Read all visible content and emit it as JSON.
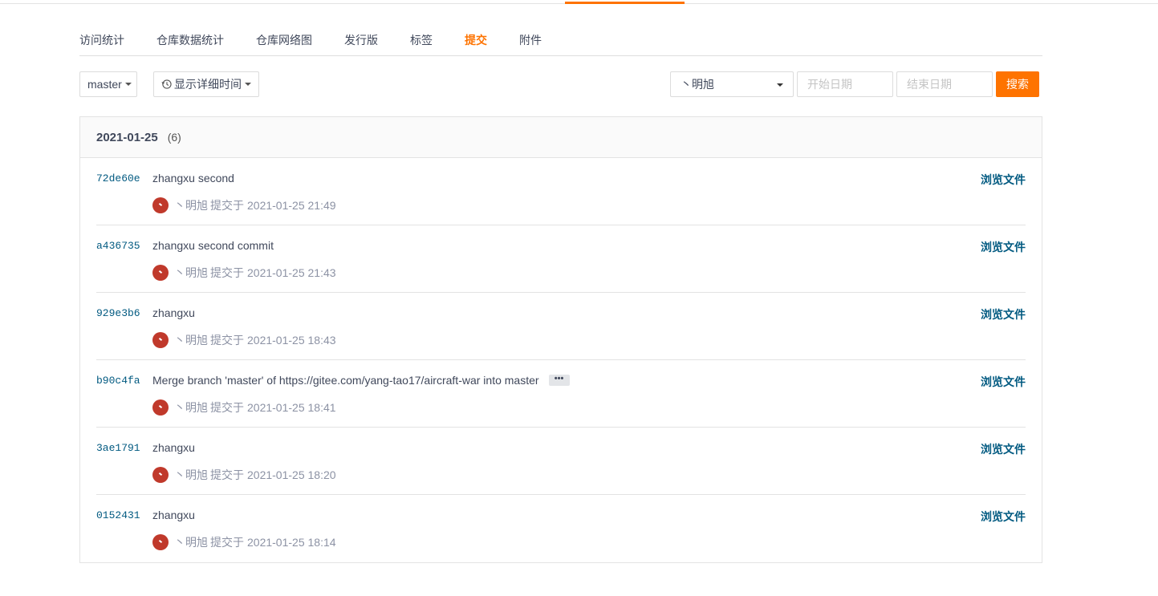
{
  "colors": {
    "accent": "#fe7300",
    "link": "#005980",
    "text": "#40485b",
    "muted": "#8c92a4",
    "avatar_bg": "#c0392b"
  },
  "subnav": {
    "items": [
      {
        "label": "访问统计"
      },
      {
        "label": "仓库数据统计"
      },
      {
        "label": "仓库网络图"
      },
      {
        "label": "发行版"
      },
      {
        "label": "标签"
      },
      {
        "label": "提交",
        "active": true
      },
      {
        "label": "附件"
      }
    ]
  },
  "toolbar": {
    "branch_label": "master",
    "time_toggle_label": "显示详细时间",
    "author_value": "丶明旭",
    "start_date_placeholder": "开始日期",
    "end_date_placeholder": "结束日期",
    "search_label": "搜索"
  },
  "group": {
    "date": "2021-01-25",
    "count": "(6)"
  },
  "commits": [
    {
      "sha": "72de60e",
      "message": "zhangxu second",
      "author": "丶明旭",
      "action": "提交于",
      "time": "2021-01-25 21:49",
      "browse": "浏览文件"
    },
    {
      "sha": "a436735",
      "message": "zhangxu second commit",
      "author": "丶明旭",
      "action": "提交于",
      "time": "2021-01-25 21:43",
      "browse": "浏览文件"
    },
    {
      "sha": "929e3b6",
      "message": "zhangxu",
      "author": "丶明旭",
      "action": "提交于",
      "time": "2021-01-25 18:43",
      "browse": "浏览文件"
    },
    {
      "sha": "b90c4fa",
      "message": "Merge branch 'master' of https://gitee.com/yang-tao17/aircraft-war into master",
      "ellipsis": "•••",
      "author": "丶明旭",
      "action": "提交于",
      "time": "2021-01-25 18:41",
      "browse": "浏览文件"
    },
    {
      "sha": "3ae1791",
      "message": "zhangxu",
      "author": "丶明旭",
      "action": "提交于",
      "time": "2021-01-25 18:20",
      "browse": "浏览文件"
    },
    {
      "sha": "0152431",
      "message": "zhangxu",
      "author": "丶明旭",
      "action": "提交于",
      "time": "2021-01-25 18:14",
      "browse": "浏览文件"
    }
  ]
}
